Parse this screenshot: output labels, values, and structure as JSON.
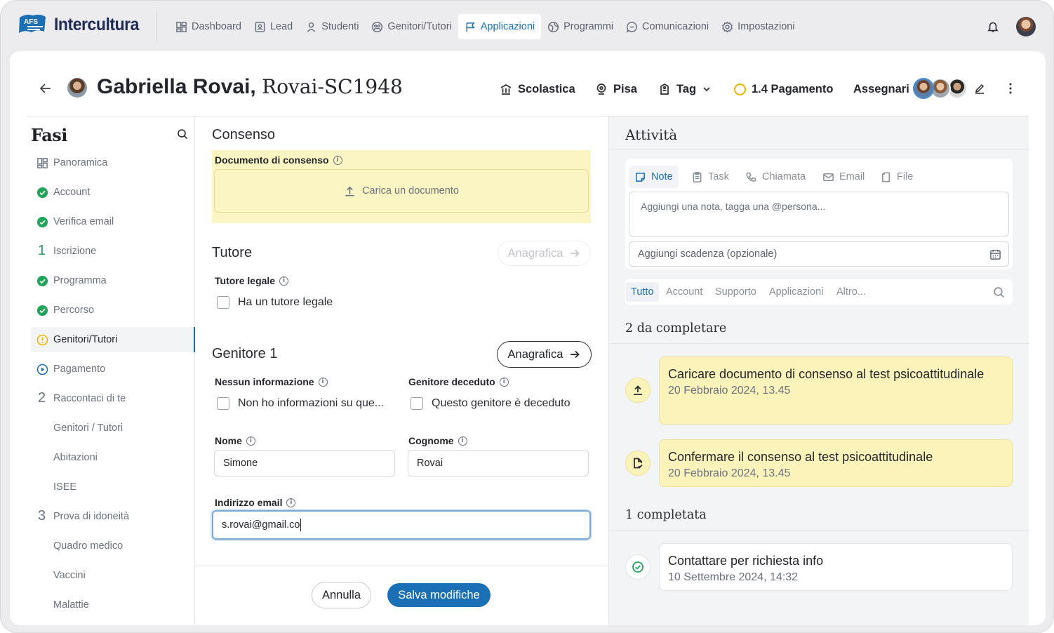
{
  "app": {
    "name": "Intercultura",
    "logo_badge": "AFS"
  },
  "nav": [
    {
      "label": "Dashboard",
      "icon": "grid-icon"
    },
    {
      "label": "Lead",
      "icon": "id-card-icon"
    },
    {
      "label": "Studenti",
      "icon": "user-icon"
    },
    {
      "label": "Genitori/Tutori",
      "icon": "users-circle-icon"
    },
    {
      "label": "Applicazioni",
      "icon": "flag-icon",
      "active": true
    },
    {
      "label": "Programmi",
      "icon": "globe-icon"
    },
    {
      "label": "Comunicazioni",
      "icon": "chat-icon"
    },
    {
      "label": "Impostazioni",
      "icon": "gear-icon"
    }
  ],
  "header": {
    "name": "Gabriella Rovai,",
    "code": "Rovai-SC1948",
    "school": "Scolastica",
    "city": "Pisa",
    "tag": "Tag",
    "payment": "1.4 Pagamento",
    "assign": "Assegnari"
  },
  "sidebar": {
    "title": "Fasi",
    "items": [
      {
        "label": "Panoramica",
        "marker": "grid"
      },
      {
        "label": "Account",
        "marker": "check"
      },
      {
        "label": "Verifica email",
        "marker": "check"
      },
      {
        "label": "Iscrizione",
        "marker": "1"
      },
      {
        "label": "Programma",
        "marker": "check"
      },
      {
        "label": "Percorso",
        "marker": "check"
      },
      {
        "label": "Genitori/Tutori",
        "marker": "warn",
        "active": true
      },
      {
        "label": "Pagamento",
        "marker": "play"
      },
      {
        "label": "Raccontaci di te",
        "marker": "2"
      },
      {
        "label": "Genitori / Tutori",
        "marker": ""
      },
      {
        "label": "Abitazioni",
        "marker": ""
      },
      {
        "label": "ISEE",
        "marker": ""
      },
      {
        "label": "Prova di idoneità",
        "marker": "3"
      },
      {
        "label": "Quadro medico",
        "marker": ""
      },
      {
        "label": "Vaccini",
        "marker": ""
      },
      {
        "label": "Malattie",
        "marker": ""
      }
    ]
  },
  "form": {
    "consent_title": "Consenso",
    "consent_doc_label": "Documento di consenso",
    "upload_label": "Carica un documento",
    "tutor_title": "Tutore",
    "anagrafica_label": "Anagrafica",
    "tutor_legal_label": "Tutore legale",
    "tutor_checkbox": "Ha un tutore legale",
    "parent_title": "Genitore 1",
    "no_info_label": "Nessun informazione",
    "no_info_checkbox": "Non ho informazioni su que...",
    "deceased_label": "Genitore deceduto",
    "deceased_checkbox": "Questo genitore è deceduto",
    "first_name_label": "Nome",
    "first_name_value": "Simone",
    "last_name_label": "Cognome",
    "last_name_value": "Rovai",
    "email_label": "Indirizzo email",
    "email_value": "s.rovai@gmail.co",
    "cancel": "Annulla",
    "save": "Salva modifiche"
  },
  "activity": {
    "title": "Attività",
    "note_tabs": [
      "Note",
      "Task",
      "Chiamata",
      "Email",
      "File"
    ],
    "note_placeholder": "Aggiungi una nota, tagga una @persona...",
    "deadline_placeholder": "Aggiungi scadenza (opzionale)",
    "filter_tabs": [
      "Tutto",
      "Account",
      "Supporto",
      "Applicazioni",
      "Altro..."
    ],
    "pending_title": "2 da completare",
    "pending": [
      {
        "title": "Caricare documento di consenso al test psicoattitudinale",
        "date": "20 Febbraio 2024, 13.45",
        "icon": "upload-icon"
      },
      {
        "title": "Confermare il consenso al test psicoattitudinale",
        "date": "20 Febbraio 2024, 13.45",
        "icon": "file-check-icon"
      }
    ],
    "done_title": "1 completata",
    "done": [
      {
        "title": "Contattare per richiesta info",
        "date": "10 Settembre 2024, 14:32",
        "icon": "check-circle-icon"
      }
    ]
  },
  "colors": {
    "accent": "#1a6fb5",
    "success": "#22a35a",
    "warning": "#f0b400",
    "highlight": "#fbf4c3"
  }
}
